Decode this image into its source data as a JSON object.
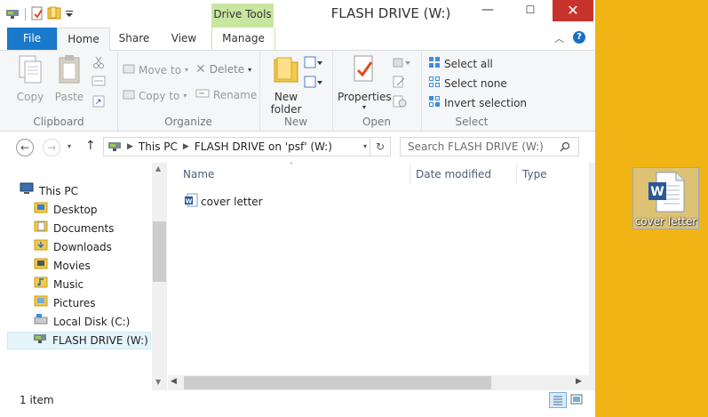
{
  "window": {
    "title": "FLASH DRIVE (W:)",
    "context_tab": "Drive Tools",
    "close_glyph": "✕",
    "minimize_glyph": "—",
    "maximize_glyph": "☐"
  },
  "tabs": [
    "File",
    "Home",
    "Share",
    "View",
    "Manage"
  ],
  "ribbon": {
    "clipboard": {
      "copy": "Copy",
      "paste": "Paste",
      "label": "Clipboard"
    },
    "organize": {
      "move_to": "Move to",
      "copy_to": "Copy to",
      "delete": "Delete",
      "rename": "Rename",
      "label": "Organize"
    },
    "new": {
      "new_folder_line1": "New",
      "new_folder_line2": "folder",
      "label": "New"
    },
    "open": {
      "properties": "Properties",
      "label": "Open"
    },
    "select": {
      "select_all": "Select all",
      "select_none": "Select none",
      "invert_selection": "Invert selection",
      "label": "Select"
    }
  },
  "address": {
    "crumbs": [
      "This PC",
      "FLASH DRIVE on 'psf' (W:)"
    ],
    "search_placeholder": "Search FLASH DRIVE (W:)"
  },
  "nav": {
    "root": "This PC",
    "items": [
      "Desktop",
      "Documents",
      "Downloads",
      "Movies",
      "Music",
      "Pictures",
      "Local Disk (C:)",
      "FLASH DRIVE (W:)"
    ]
  },
  "columns": [
    "Name",
    "Date modified",
    "Type"
  ],
  "files": [
    {
      "name": "cover letter",
      "icon": "word-doc-icon"
    }
  ],
  "status": {
    "item_count": "1 item"
  },
  "desktop": {
    "icon_label": "cover letter"
  },
  "colors": {
    "accent": "#1979ca",
    "close": "#c7332b",
    "context_tab": "#c8e6a0",
    "desktop": "#f0b414"
  }
}
